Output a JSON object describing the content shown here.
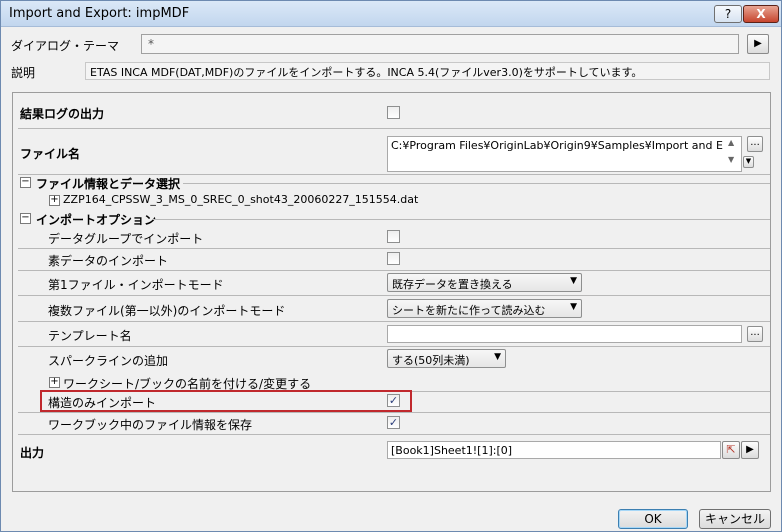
{
  "window": {
    "title": "Import and Export: impMDF",
    "help_label": "?",
    "close_label": "X"
  },
  "theme": {
    "label": "ダイアログ・テーマ",
    "value": "*",
    "arrow": "▶"
  },
  "description": {
    "label": "説明",
    "text": "ETAS INCA MDF(DAT,MDF)のファイルをインポートする。INCA 5.4(ファイルver3.0)をサポートしています。"
  },
  "log": {
    "label": "結果ログの出力",
    "checked": false
  },
  "file": {
    "label": "ファイル名",
    "value": "C:¥Program Files¥OriginLab¥Origin9¥Samples¥Import and E",
    "browse": "..."
  },
  "file_info": {
    "header": "ファイル情報とデータ選択",
    "collapse_sign": "⊟",
    "item": "ZZP164_CPSSW_3_MS_0_SREC_0_shot43_20060227_151554.dat"
  },
  "import_options": {
    "header": "インポートオプション",
    "data_group": {
      "label": "データグループでインポート",
      "checked": false
    },
    "raw_data": {
      "label": "素データのインポート",
      "checked": false
    },
    "first_mode": {
      "label": "第1ファイル・インポートモード",
      "value": "既存データを置き換える"
    },
    "multi_mode": {
      "label": "複数ファイル(第一以外)のインポートモード",
      "value": "シートを新たに作って読み込む"
    },
    "template": {
      "label": "テンプレート名",
      "value": "",
      "browse": "..."
    },
    "sparkline": {
      "label": "スパークラインの追加",
      "value": "する(50列未満)"
    },
    "rename": {
      "label": "ワークシート/ブックの名前を付ける/変更する"
    },
    "structure_only": {
      "label": "構造のみインポート",
      "checked": true
    },
    "save_info": {
      "label": "ワークブック中のファイル情報を保存",
      "checked": true
    }
  },
  "output": {
    "label": "出力",
    "value": "[Book1]Sheet1![1]:[0]"
  },
  "buttons": {
    "ok": "OK",
    "cancel": "キャンセル"
  }
}
